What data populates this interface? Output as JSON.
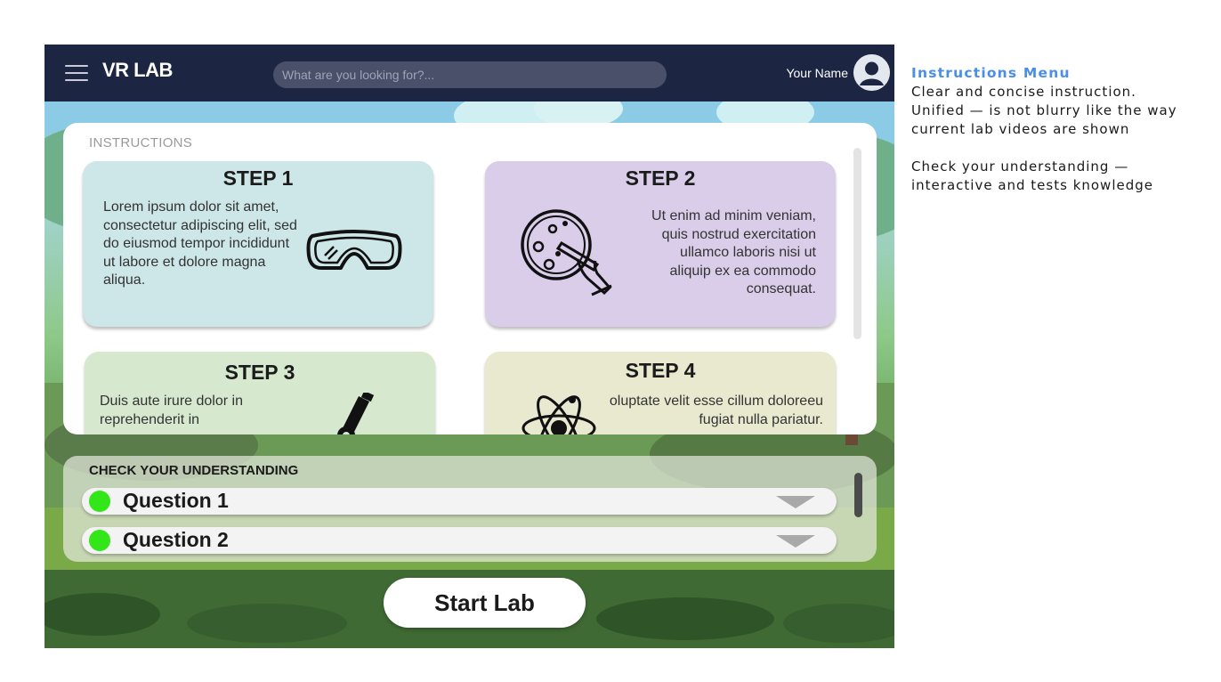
{
  "app": {
    "brand": "VR LAB",
    "search_placeholder": "What are you looking for?...",
    "user_name": "Your Name"
  },
  "instructions": {
    "heading": "INSTRUCTIONS",
    "steps": [
      {
        "title": "STEP 1",
        "text": "Lorem ipsum dolor sit amet, consectetur adipiscing elit, sed do eiusmod tempor incididunt ut labore et dolore magna aliqua.",
        "icon": "safety-goggles-icon",
        "color": "#cde6e7"
      },
      {
        "title": "STEP 2",
        "text": "Ut enim ad minim veniam, quis nostrud exercitation ullamco laboris nisi ut aliquip ex ea commodo consequat.",
        "icon": "petri-dish-icon",
        "color": "#d9cde9"
      },
      {
        "title": "STEP 3",
        "text": "Duis aute irure dolor in reprehenderit in",
        "icon": "microscope-icon",
        "color": "#d6e9cf"
      },
      {
        "title": "STEP 4",
        "text": "oluptate velit esse cillum doloreeu fugiat nulla pariatur.",
        "icon": "atom-icon",
        "color": "#e8e9cf"
      }
    ]
  },
  "check": {
    "heading": "CHECK YOUR UNDERSTANDING",
    "questions": [
      {
        "label": "Question 1",
        "status_color": "#33e61a"
      },
      {
        "label": "Question 2",
        "status_color": "#33e61a"
      }
    ]
  },
  "start_button": "Start Lab",
  "notes": {
    "title": "Instructions Menu",
    "para1": "Clear and concise instruction. Unified — is not blurry like the way current lab videos are shown",
    "para2": "Check your understanding — interactive and tests knowledge"
  }
}
